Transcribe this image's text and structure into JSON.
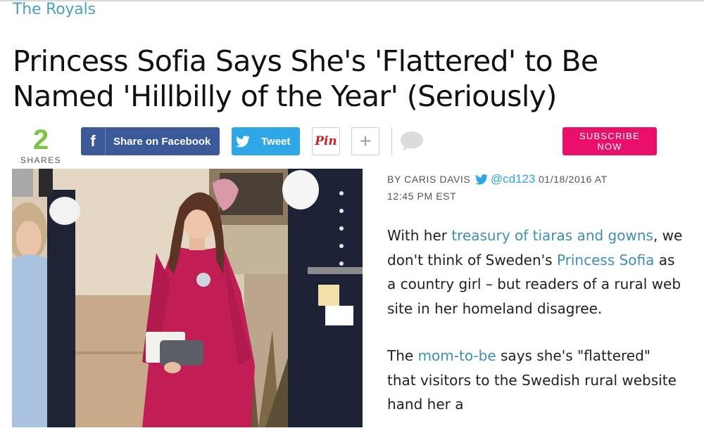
{
  "section": {
    "label": "The Royals"
  },
  "article": {
    "headline_line1": "Princess Sofia Says She's 'Flattered' to Be",
    "headline_line2": "Named 'Hillbilly of the Year' (Seriously)"
  },
  "share_bar": {
    "count": "2",
    "count_label": "SHARES",
    "facebook_icon": "f",
    "facebook_label": "Share on Facebook",
    "tweet_label": "Tweet",
    "pin_label": "Pin",
    "more_label": "+",
    "subscribe_label": "SUBSCRIBE NOW"
  },
  "byline": {
    "prefix": "BY CARIS DAVIS",
    "handle": "@cd123",
    "date": "01/18/2016 AT",
    "time": "12:45 PM EST"
  },
  "body": {
    "p1_pre": "With her ",
    "p1_link1": "treasury of tiaras and gowns",
    "p1_mid": ", we don't think of Sweden's ",
    "p1_link2": "Princess Sofia",
    "p1_post": " as a country girl – but readers of a rural web site in her homeland disagree.",
    "p2_pre": "The ",
    "p2_link": "mom-to-be",
    "p2_post": " says she's \"flattered\" that visitors to the Swedish rural website hand her a"
  },
  "colors": {
    "section_label": "#4f9fc0",
    "shares_count": "#7cc243",
    "facebook": "#3b5998",
    "twitter": "#2fa6e6",
    "pinterest": "#cb2027",
    "subscribe": "#ea0f6b",
    "link": "#3f8fb5"
  },
  "icons": {
    "facebook": "facebook-icon",
    "twitter": "twitter-bird-icon",
    "pinterest": "pinterest-icon",
    "more": "plus-icon",
    "comment": "comment-bubble-icon"
  }
}
